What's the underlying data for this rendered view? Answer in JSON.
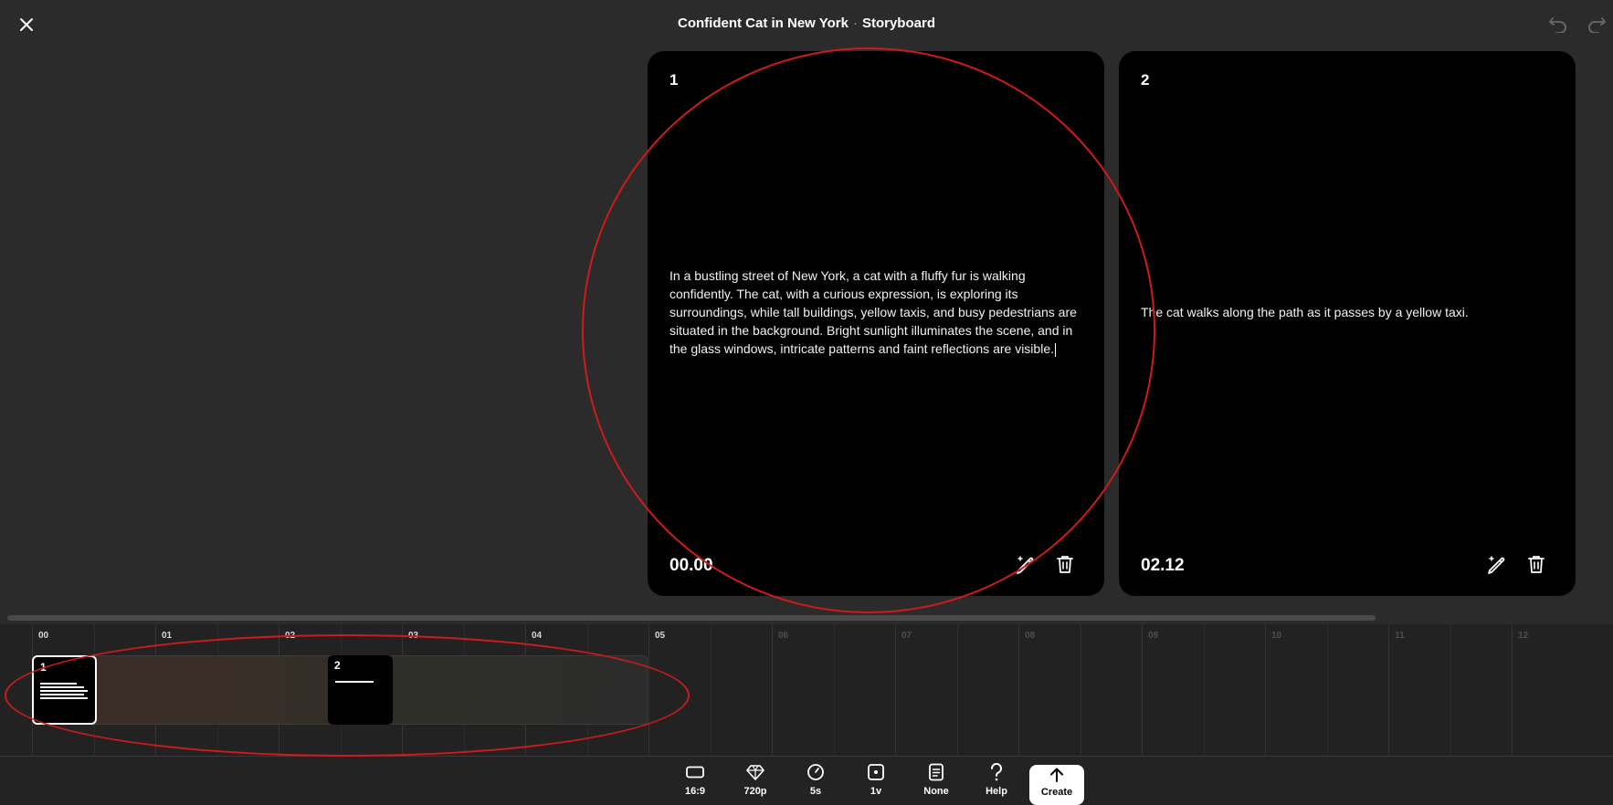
{
  "header": {
    "title": "Confident Cat in New York",
    "separator": "·",
    "section": "Storyboard"
  },
  "cards": [
    {
      "number": "1",
      "description": "In a bustling street of New York, a cat with a fluffy fur is walking confidently. The cat, with a curious expression, is exploring its surroundings, while tall buildings, yellow taxis, and busy pedestrians are situated in the background. Bright sunlight illuminates the scene, and in the glass windows, intricate patterns and faint reflections are visible.",
      "time": "00.00"
    },
    {
      "number": "2",
      "description": "The cat walks along the path as it passes by a yellow taxi.",
      "time": "02.12"
    }
  ],
  "timeline": {
    "ticks": [
      "00",
      "01",
      "02",
      "03",
      "04",
      "05",
      "06",
      "07",
      "08",
      "09",
      "10",
      "11",
      "12"
    ],
    "clips": [
      {
        "number": "1"
      },
      {
        "number": "2"
      }
    ]
  },
  "toolbar": {
    "aspect": "16:9",
    "quality": "720p",
    "duration": "5s",
    "versions": "1v",
    "style": "None",
    "help": "Help",
    "create": "Create"
  },
  "colors": {
    "background": "#2b2b2b",
    "card": "#000000",
    "annotation": "#d11a1a",
    "timeline": "#222222"
  },
  "icons": [
    "close-icon",
    "undo-icon",
    "redo-icon",
    "magic-pen-icon",
    "trash-icon",
    "aspect-ratio-icon",
    "diamond-icon",
    "clock-icon",
    "version-icon",
    "document-icon",
    "question-icon",
    "arrow-up-icon"
  ]
}
